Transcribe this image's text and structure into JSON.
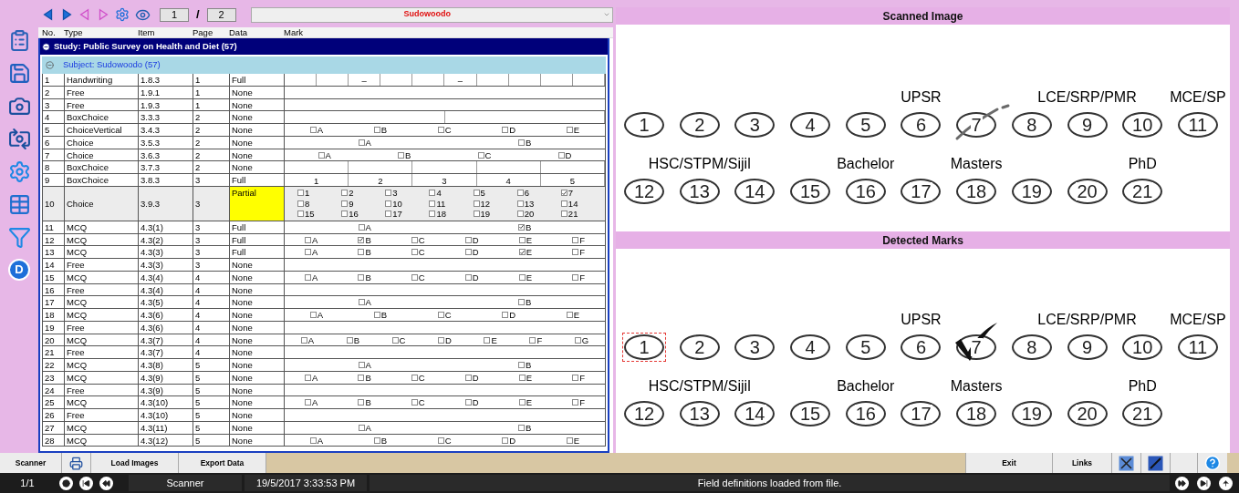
{
  "toolbar": {
    "page": "1",
    "separator": "/",
    "page_count": "2",
    "subject": "Sudowoodo"
  },
  "sidebar": {
    "logo": "D"
  },
  "table": {
    "columns": [
      "No.",
      "Type",
      "Item",
      "Page",
      "Data",
      "Mark"
    ],
    "study": {
      "label": "Study: Public Survey on Health and Diet (57)",
      "expanded": true
    },
    "subject": {
      "label": "Subject: Sudowoodo (57)",
      "expanded": true
    },
    "rows": [
      {
        "no": "1",
        "type": "Handwriting",
        "item": "1.8.3",
        "page": "1",
        "data": "Full",
        "selected": false,
        "flagged": false,
        "mark": {
          "kind": "cells",
          "cells": [
            {},
            {},
            {
              "text": "–"
            },
            {},
            {},
            {
              "text": "–"
            },
            {},
            {},
            {},
            {}
          ]
        }
      },
      {
        "no": "2",
        "type": "Free",
        "item": "1.9.1",
        "page": "1",
        "data": "None",
        "selected": false,
        "flagged": false,
        "mark": {
          "kind": "blank"
        }
      },
      {
        "no": "3",
        "type": "Free",
        "item": "1.9.3",
        "page": "1",
        "data": "None",
        "selected": false,
        "flagged": false,
        "mark": {
          "kind": "blank"
        }
      },
      {
        "no": "4",
        "type": "BoxChoice",
        "item": "3.3.3",
        "page": "2",
        "data": "None",
        "selected": false,
        "flagged": false,
        "mark": {
          "kind": "cells",
          "cells": [
            {},
            {}
          ]
        }
      },
      {
        "no": "5",
        "type": "ChoiceVertical",
        "item": "3.4.3",
        "page": "2",
        "data": "None",
        "selected": false,
        "flagged": false,
        "mark": {
          "kind": "options",
          "options": [
            {
              "label": "A",
              "checked": false
            },
            {
              "label": "B",
              "checked": false
            },
            {
              "label": "C",
              "checked": false
            },
            {
              "label": "D",
              "checked": false
            },
            {
              "label": "E",
              "checked": false
            }
          ]
        }
      },
      {
        "no": "6",
        "type": "Choice",
        "item": "3.5.3",
        "page": "2",
        "data": "None",
        "selected": false,
        "flagged": false,
        "mark": {
          "kind": "options",
          "options": [
            {
              "label": "A",
              "checked": false
            },
            {
              "label": "B",
              "checked": false
            }
          ]
        }
      },
      {
        "no": "7",
        "type": "Choice",
        "item": "3.6.3",
        "page": "2",
        "data": "None",
        "selected": false,
        "flagged": false,
        "mark": {
          "kind": "options",
          "options": [
            {
              "label": "A",
              "checked": false
            },
            {
              "label": "B",
              "checked": false
            },
            {
              "label": "C",
              "checked": false
            },
            {
              "label": "D",
              "checked": false
            }
          ]
        }
      },
      {
        "no": "8",
        "type": "BoxChoice",
        "item": "3.7.3",
        "page": "2",
        "data": "None",
        "selected": false,
        "flagged": false,
        "mark": {
          "kind": "cells",
          "cells": [
            {},
            {},
            {},
            {},
            {}
          ]
        }
      },
      {
        "no": "9",
        "type": "BoxChoice",
        "item": "3.8.3",
        "page": "3",
        "data": "Full",
        "selected": false,
        "flagged": false,
        "mark": {
          "kind": "cells",
          "cells": [
            {
              "text": "1"
            },
            {
              "text": "2"
            },
            {
              "text": "3"
            },
            {
              "text": "4"
            },
            {
              "text": "5"
            }
          ]
        }
      },
      {
        "no": "10",
        "type": "Choice",
        "item": "3.9.3",
        "page": "3",
        "data": "Partial",
        "selected": true,
        "flagged": true,
        "mark": {
          "kind": "grid",
          "options": [
            {
              "label": "1",
              "checked": false
            },
            {
              "label": "2",
              "checked": false
            },
            {
              "label": "3",
              "checked": false
            },
            {
              "label": "4",
              "checked": false
            },
            {
              "label": "5",
              "checked": false
            },
            {
              "label": "6",
              "checked": false
            },
            {
              "label": "7",
              "checked": true
            },
            {
              "label": "8",
              "checked": false
            },
            {
              "label": "9",
              "checked": false
            },
            {
              "label": "10",
              "checked": false
            },
            {
              "label": "11",
              "checked": false
            },
            {
              "label": "12",
              "checked": false
            },
            {
              "label": "13",
              "checked": false
            },
            {
              "label": "14",
              "checked": false
            },
            {
              "label": "15",
              "checked": false
            },
            {
              "label": "16",
              "checked": false
            },
            {
              "label": "17",
              "checked": false
            },
            {
              "label": "18",
              "checked": false
            },
            {
              "label": "19",
              "checked": false
            },
            {
              "label": "20",
              "checked": false
            },
            {
              "label": "21",
              "checked": false
            }
          ]
        }
      },
      {
        "no": "11",
        "type": "MCQ",
        "item": "4.3(1)",
        "page": "3",
        "data": "Full",
        "selected": false,
        "flagged": false,
        "mark": {
          "kind": "options",
          "options": [
            {
              "label": "A",
              "checked": false
            },
            {
              "label": "B",
              "checked": true
            }
          ]
        }
      },
      {
        "no": "12",
        "type": "MCQ",
        "item": "4.3(2)",
        "page": "3",
        "data": "Full",
        "selected": false,
        "flagged": false,
        "mark": {
          "kind": "options",
          "options": [
            {
              "label": "A",
              "checked": false
            },
            {
              "label": "B",
              "checked": true
            },
            {
              "label": "C",
              "checked": false
            },
            {
              "label": "D",
              "checked": false
            },
            {
              "label": "E",
              "checked": false
            },
            {
              "label": "F",
              "checked": false
            }
          ]
        }
      },
      {
        "no": "13",
        "type": "MCQ",
        "item": "4.3(3)",
        "page": "3",
        "data": "Full",
        "selected": false,
        "flagged": false,
        "mark": {
          "kind": "options",
          "options": [
            {
              "label": "A",
              "checked": false
            },
            {
              "label": "B",
              "checked": false
            },
            {
              "label": "C",
              "checked": false
            },
            {
              "label": "D",
              "checked": false
            },
            {
              "label": "E",
              "checked": true
            },
            {
              "label": "F",
              "checked": false
            }
          ]
        }
      },
      {
        "no": "14",
        "type": "Free",
        "item": "4.3(3)",
        "page": "3",
        "data": "None",
        "selected": false,
        "flagged": false,
        "mark": {
          "kind": "blank"
        }
      },
      {
        "no": "15",
        "type": "MCQ",
        "item": "4.3(4)",
        "page": "4",
        "data": "None",
        "selected": false,
        "flagged": false,
        "mark": {
          "kind": "options",
          "options": [
            {
              "label": "A",
              "checked": false
            },
            {
              "label": "B",
              "checked": false
            },
            {
              "label": "C",
              "checked": false
            },
            {
              "label": "D",
              "checked": false
            },
            {
              "label": "E",
              "checked": false
            },
            {
              "label": "F",
              "checked": false
            }
          ]
        }
      },
      {
        "no": "16",
        "type": "Free",
        "item": "4.3(4)",
        "page": "4",
        "data": "None",
        "selected": false,
        "flagged": false,
        "mark": {
          "kind": "blank"
        }
      },
      {
        "no": "17",
        "type": "MCQ",
        "item": "4.3(5)",
        "page": "4",
        "data": "None",
        "selected": false,
        "flagged": false,
        "mark": {
          "kind": "options",
          "options": [
            {
              "label": "A",
              "checked": false
            },
            {
              "label": "B",
              "checked": false
            }
          ]
        }
      },
      {
        "no": "18",
        "type": "MCQ",
        "item": "4.3(6)",
        "page": "4",
        "data": "None",
        "selected": false,
        "flagged": false,
        "mark": {
          "kind": "options",
          "options": [
            {
              "label": "A",
              "checked": false
            },
            {
              "label": "B",
              "checked": false
            },
            {
              "label": "C",
              "checked": false
            },
            {
              "label": "D",
              "checked": false
            },
            {
              "label": "E",
              "checked": false
            }
          ]
        }
      },
      {
        "no": "19",
        "type": "Free",
        "item": "4.3(6)",
        "page": "4",
        "data": "None",
        "selected": false,
        "flagged": false,
        "mark": {
          "kind": "blank"
        }
      },
      {
        "no": "20",
        "type": "MCQ",
        "item": "4.3(7)",
        "page": "4",
        "data": "None",
        "selected": false,
        "flagged": false,
        "mark": {
          "kind": "options",
          "options": [
            {
              "label": "A",
              "checked": false
            },
            {
              "label": "B",
              "checked": false
            },
            {
              "label": "C",
              "checked": false
            },
            {
              "label": "D",
              "checked": false
            },
            {
              "label": "E",
              "checked": false
            },
            {
              "label": "F",
              "checked": false
            },
            {
              "label": "G",
              "checked": false
            }
          ]
        }
      },
      {
        "no": "21",
        "type": "Free",
        "item": "4.3(7)",
        "page": "4",
        "data": "None",
        "selected": false,
        "flagged": false,
        "mark": {
          "kind": "blank"
        }
      },
      {
        "no": "22",
        "type": "MCQ",
        "item": "4.3(8)",
        "page": "5",
        "data": "None",
        "selected": false,
        "flagged": false,
        "mark": {
          "kind": "options",
          "options": [
            {
              "label": "A",
              "checked": false
            },
            {
              "label": "B",
              "checked": false
            }
          ]
        }
      },
      {
        "no": "23",
        "type": "MCQ",
        "item": "4.3(9)",
        "page": "5",
        "data": "None",
        "selected": false,
        "flagged": false,
        "mark": {
          "kind": "options",
          "options": [
            {
              "label": "A",
              "checked": false
            },
            {
              "label": "B",
              "checked": false
            },
            {
              "label": "C",
              "checked": false
            },
            {
              "label": "D",
              "checked": false
            },
            {
              "label": "E",
              "checked": false
            },
            {
              "label": "F",
              "checked": false
            }
          ]
        }
      },
      {
        "no": "24",
        "type": "Free",
        "item": "4.3(9)",
        "page": "5",
        "data": "None",
        "selected": false,
        "flagged": false,
        "mark": {
          "kind": "blank"
        }
      },
      {
        "no": "25",
        "type": "MCQ",
        "item": "4.3(10)",
        "page": "5",
        "data": "None",
        "selected": false,
        "flagged": false,
        "mark": {
          "kind": "options",
          "options": [
            {
              "label": "A",
              "checked": false
            },
            {
              "label": "B",
              "checked": false
            },
            {
              "label": "C",
              "checked": false
            },
            {
              "label": "D",
              "checked": false
            },
            {
              "label": "E",
              "checked": false
            },
            {
              "label": "F",
              "checked": false
            }
          ]
        }
      },
      {
        "no": "26",
        "type": "Free",
        "item": "4.3(10)",
        "page": "5",
        "data": "None",
        "selected": false,
        "flagged": false,
        "mark": {
          "kind": "blank"
        }
      },
      {
        "no": "27",
        "type": "MCQ",
        "item": "4.3(11)",
        "page": "5",
        "data": "None",
        "selected": false,
        "flagged": false,
        "mark": {
          "kind": "options",
          "options": [
            {
              "label": "A",
              "checked": false
            },
            {
              "label": "B",
              "checked": false
            }
          ]
        }
      },
      {
        "no": "28",
        "type": "MCQ",
        "item": "4.3(12)",
        "page": "5",
        "data": "None",
        "selected": false,
        "flagged": false,
        "mark": {
          "kind": "options",
          "options": [
            {
              "label": "A",
              "checked": false
            },
            {
              "label": "B",
              "checked": false
            },
            {
              "label": "C",
              "checked": false
            },
            {
              "label": "D",
              "checked": false
            },
            {
              "label": "E",
              "checked": false
            }
          ]
        }
      }
    ]
  },
  "image_panels": [
    {
      "title": "Scanned Image",
      "kind": "scanned",
      "rows": [
        {
          "ovals": [
            {
              "text": "1",
              "marked": false,
              "focused": false
            },
            {
              "text": "2",
              "marked": false,
              "focused": false
            },
            {
              "text": "3",
              "marked": false,
              "focused": false
            },
            {
              "text": "4",
              "marked": false,
              "focused": false
            },
            {
              "text": "5",
              "marked": false,
              "focused": false
            },
            {
              "text": "6",
              "caption": "UPSR",
              "marked": false,
              "focused": false
            },
            {
              "text": "7",
              "marked": true,
              "focused": false
            },
            {
              "text": "8",
              "marked": false,
              "focused": false
            },
            {
              "text": "9",
              "caption": "LCE/SRP/PMR",
              "marked": false,
              "focused": false
            },
            {
              "text": "10",
              "marked": false,
              "focused": false
            },
            {
              "text": "11",
              "caption": "MCE/SP",
              "marked": false,
              "focused": false
            }
          ]
        },
        {
          "ovals": [
            {
              "text": "12",
              "marked": false,
              "focused": false
            },
            {
              "text": "13",
              "caption": "HSC/STPM/Sijil",
              "marked": false,
              "focused": false
            },
            {
              "text": "14",
              "marked": false,
              "focused": false
            },
            {
              "text": "15",
              "marked": false,
              "focused": false
            },
            {
              "text": "16",
              "caption": "Bachelor",
              "marked": false,
              "focused": false
            },
            {
              "text": "17",
              "marked": false,
              "focused": false
            },
            {
              "text": "18",
              "caption": "Masters",
              "marked": false,
              "focused": false
            },
            {
              "text": "19",
              "marked": false,
              "focused": false
            },
            {
              "text": "20",
              "marked": false,
              "focused": false
            },
            {
              "text": "21",
              "caption": "PhD",
              "marked": false,
              "focused": false
            }
          ]
        }
      ]
    },
    {
      "title": "Detected Marks",
      "kind": "detected",
      "rows": [
        {
          "ovals": [
            {
              "text": "1",
              "marked": false,
              "focused": true
            },
            {
              "text": "2",
              "marked": false,
              "focused": false
            },
            {
              "text": "3",
              "marked": false,
              "focused": false
            },
            {
              "text": "4",
              "marked": false,
              "focused": false
            },
            {
              "text": "5",
              "marked": false,
              "focused": false
            },
            {
              "text": "6",
              "caption": "UPSR",
              "marked": false,
              "focused": false
            },
            {
              "text": "7",
              "marked": true,
              "focused": false
            },
            {
              "text": "8",
              "marked": false,
              "focused": false
            },
            {
              "text": "9",
              "caption": "LCE/SRP/PMR",
              "marked": false,
              "focused": false
            },
            {
              "text": "10",
              "marked": false,
              "focused": false
            },
            {
              "text": "11",
              "caption": "MCE/SP",
              "marked": false,
              "focused": false
            }
          ]
        },
        {
          "ovals": [
            {
              "text": "12",
              "marked": false,
              "focused": false
            },
            {
              "text": "13",
              "caption": "HSC/STPM/Sijil",
              "marked": false,
              "focused": false
            },
            {
              "text": "14",
              "marked": false,
              "focused": false
            },
            {
              "text": "15",
              "marked": false,
              "focused": false
            },
            {
              "text": "16",
              "caption": "Bachelor",
              "marked": false,
              "focused": false
            },
            {
              "text": "17",
              "marked": false,
              "focused": false
            },
            {
              "text": "18",
              "caption": "Masters",
              "marked": false,
              "focused": false
            },
            {
              "text": "19",
              "marked": false,
              "focused": false
            },
            {
              "text": "20",
              "marked": false,
              "focused": false
            },
            {
              "text": "21",
              "caption": "PhD",
              "marked": false,
              "focused": false
            }
          ]
        }
      ]
    }
  ],
  "bottom_toolbar": {
    "left": [
      "Scanner",
      "Load Images",
      "Export Data"
    ],
    "right": [
      "Exit",
      "Links"
    ]
  },
  "status_bar": {
    "page": "1/1",
    "mode": "Scanner",
    "datetime": "19/5/2017 3:33:53 PM",
    "message": "Field definitions loaded from file."
  }
}
